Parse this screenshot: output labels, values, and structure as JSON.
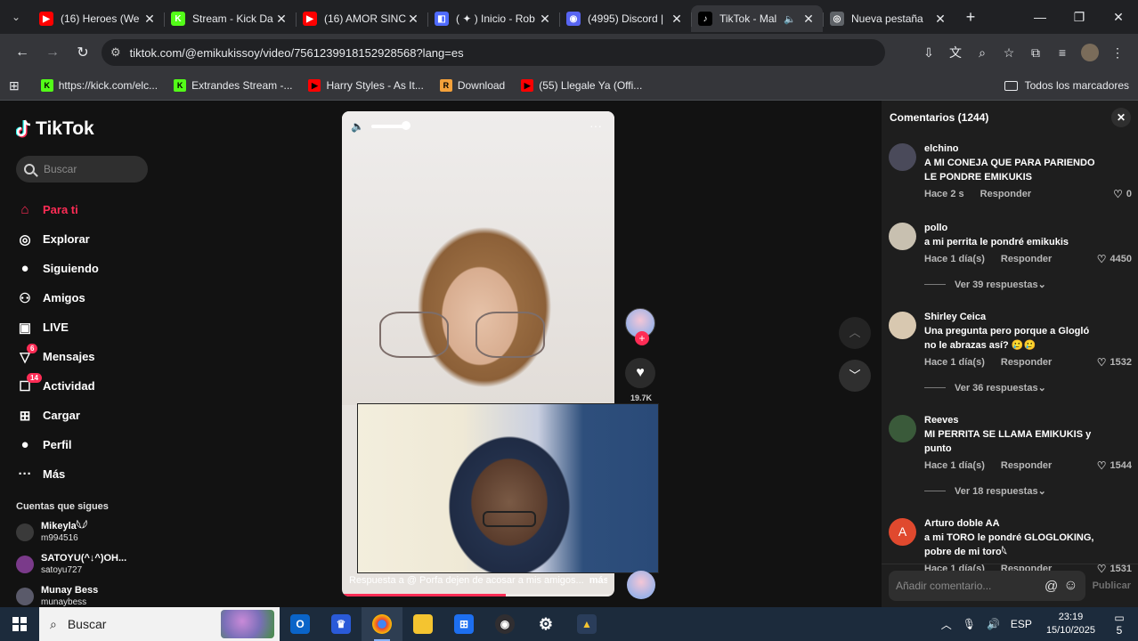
{
  "browser": {
    "tabs": [
      {
        "title": "(16) Heroes (We",
        "color": "#ff0000",
        "fav": "▶"
      },
      {
        "title": "Stream - Kick Da",
        "color": "#53fc18",
        "fav": "K"
      },
      {
        "title": "(16) AMOR SINC",
        "color": "#ff0000",
        "fav": "▶"
      },
      {
        "title": "( ✦ ) Inicio - Rob",
        "color": "#4f6bff",
        "fav": "◧"
      },
      {
        "title": "(4995) Discord |",
        "color": "#5865f2",
        "fav": "◉"
      },
      {
        "title": "TikTok - Mal",
        "color": "#000000",
        "fav": "♪",
        "active": true
      },
      {
        "title": "Nueva pestaña",
        "color": "#5f6368",
        "fav": "◎"
      }
    ],
    "url": "tiktok.com/@emikukissoy/video/7561239918152928568?lang=es",
    "bookmarks": [
      {
        "label": "https://kick.com/elc...",
        "color": "#53fc18",
        "fav": "K"
      },
      {
        "label": "Extrandes Stream -...",
        "color": "#53fc18",
        "fav": "K"
      },
      {
        "label": "Harry Styles - As It...",
        "color": "#ff0000",
        "fav": "▶"
      },
      {
        "label": "Download",
        "color": "#f4a13a",
        "fav": "R"
      },
      {
        "label": "(55) Llegale Ya (Offi...",
        "color": "#ff0000",
        "fav": "▶"
      }
    ],
    "all_bookmarks": "Todos los marcadores"
  },
  "tiktok": {
    "logo": "TikTok",
    "search_placeholder": "Buscar",
    "nav": [
      {
        "label": "Para ti",
        "icon": "home-icon",
        "glyph": "⌂",
        "active": true
      },
      {
        "label": "Explorar",
        "icon": "compass-icon",
        "glyph": "◎"
      },
      {
        "label": "Siguiendo",
        "icon": "following-avatar-icon",
        "glyph": "●"
      },
      {
        "label": "Amigos",
        "icon": "friends-icon",
        "glyph": "⚇"
      },
      {
        "label": "LIVE",
        "icon": "live-icon",
        "glyph": "▣"
      },
      {
        "label": "Mensajes",
        "icon": "messages-icon",
        "glyph": "▽",
        "badge": "6"
      },
      {
        "label": "Actividad",
        "icon": "activity-icon",
        "glyph": "☐",
        "badge": "14"
      },
      {
        "label": "Cargar",
        "icon": "upload-icon",
        "glyph": "⊞"
      },
      {
        "label": "Perfil",
        "icon": "profile-avatar-icon",
        "glyph": "●"
      },
      {
        "label": "Más",
        "icon": "more-icon",
        "glyph": "···"
      }
    ],
    "following_title": "Cuentas que sigues",
    "following": [
      {
        "name": "Mikeyla𓆩𓆪",
        "handle": "m994516",
        "color": "#3a3a3a"
      },
      {
        "name": "SATOYU(^↓^)OH...",
        "handle": "satoyu727",
        "color": "#7a3a8a"
      },
      {
        "name": "Munay Bess",
        "handle": "munaybess",
        "color": "#5a5a6a"
      }
    ],
    "video": {
      "caption": "Respuesta a @  Porfa dejen de acosar a mis amigos...",
      "more": "más",
      "like_count": "19.7K",
      "progress": 0.6
    },
    "comments": {
      "title": "Comentarios (1244)",
      "items": [
        {
          "user": "elchino",
          "text": "A MI CONEJA QUE PARA PARIENDO LE PONDRE EMIKUKIS",
          "time": "Hace 2 s",
          "reply": "Responder",
          "likes": "0",
          "color": "#4a4a5a"
        },
        {
          "user": "pollo",
          "text": "a mi perrita le pondré emikukis",
          "time": "Hace 1 día(s)",
          "reply": "Responder",
          "likes": "4450",
          "view_replies": "Ver 39 respuestas",
          "color": "#c8c0b0"
        },
        {
          "user": "Shirley Ceica",
          "text": "Una pregunta pero porque a Glogló no le abrazas así? 🥲🥲",
          "time": "Hace 1 día(s)",
          "reply": "Responder",
          "likes": "1532",
          "view_replies": "Ver 36 respuestas",
          "color": "#d8c8b0"
        },
        {
          "user": "Reeves",
          "text": "MI PERRITA SE LLAMA EMIKUKIS y punto",
          "time": "Hace 1 día(s)",
          "reply": "Responder",
          "likes": "1544",
          "view_replies": "Ver 18 respuestas",
          "color": "#3a5a3a"
        },
        {
          "user": "Arturo doble AA",
          "text": "a mi TORO le pondré GLOGLOKING, pobre de mi toro𓆩",
          "time": "Hace 1 día(s)",
          "reply": "Responder",
          "likes": "1531",
          "color": "#e0492e",
          "initial": "A"
        }
      ],
      "input_placeholder": "Añadir comentario...",
      "post": "Publicar"
    }
  },
  "taskbar": {
    "search": "Buscar",
    "lang": "ESP",
    "time": "23:19",
    "date": "15/10/2025",
    "notifications": "5"
  }
}
